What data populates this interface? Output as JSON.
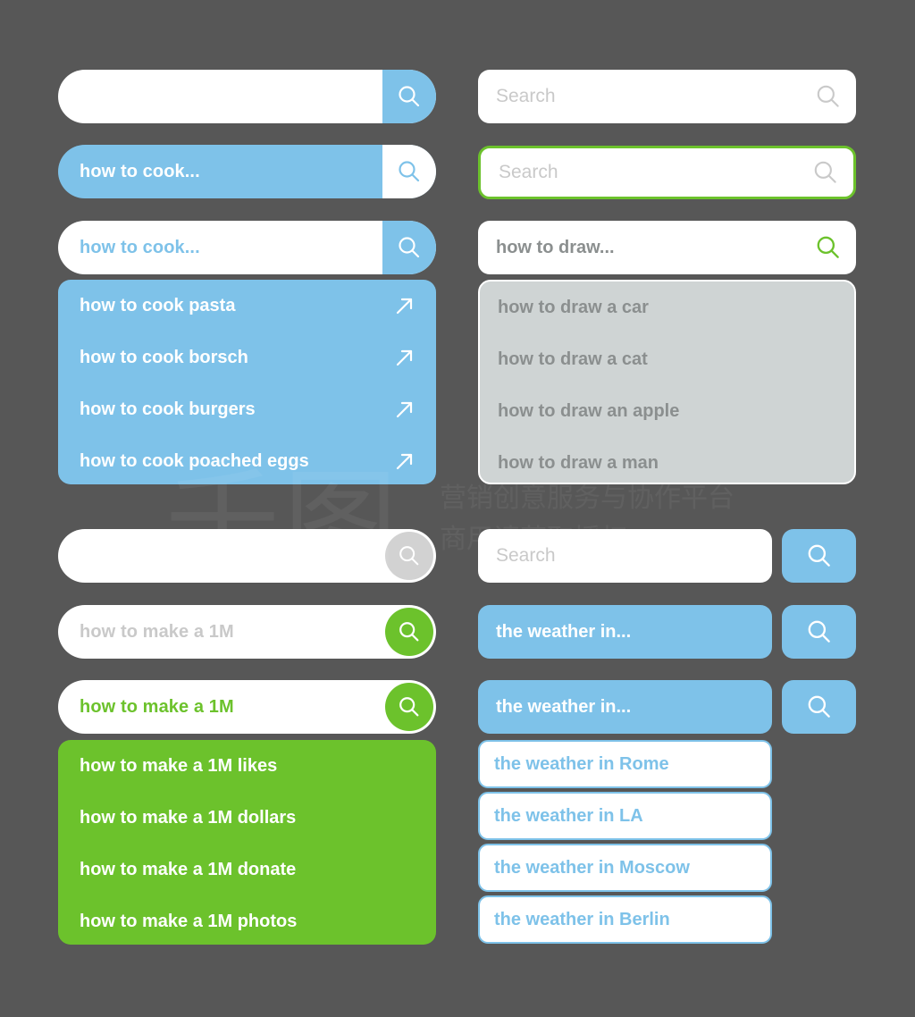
{
  "colors": {
    "background": "#575757",
    "blue": "#7ec2e9",
    "green": "#6cc22c",
    "white": "#ffffff",
    "placeholder_gray": "#c9c9c9",
    "panel_gray": "#cfd4d4",
    "panel_gray_text": "#8b8f8f",
    "icon_gray_circle": "#d2d2d2"
  },
  "left_column": {
    "bar_empty_blue_btn": {
      "value": "",
      "placeholder": "",
      "icon": "search-icon"
    },
    "bar_filled_blue": {
      "value": "how to cook...",
      "icon": "search-icon"
    },
    "bar_white_blue_text": {
      "value": "how to cook...",
      "icon": "search-icon"
    },
    "cook_suggestions": {
      "items": [
        {
          "label": "how to cook pasta",
          "icon": "arrow-up-right-icon"
        },
        {
          "label": "how to cook borsch",
          "icon": "arrow-up-right-icon"
        },
        {
          "label": "how to cook burgers",
          "icon": "arrow-up-right-icon"
        },
        {
          "label": "how to cook poached eggs",
          "icon": "arrow-up-right-icon"
        }
      ]
    },
    "bar_empty_gray_circle": {
      "value": "",
      "placeholder": "",
      "icon": "search-icon"
    },
    "bar_placeholder_green": {
      "value": "",
      "placeholder": "how to make a 1M",
      "icon": "search-icon"
    },
    "bar_filled_green": {
      "value": "how to make a 1M",
      "icon": "search-icon"
    },
    "make_suggestions": {
      "items": [
        {
          "label": "how to make a 1M likes"
        },
        {
          "label": "how to make a 1M dollars"
        },
        {
          "label": "how to make a 1M donate"
        },
        {
          "label": "how to make a 1M photos"
        }
      ]
    }
  },
  "right_column": {
    "bar_search_plain": {
      "value": "",
      "placeholder": "Search",
      "icon": "search-icon"
    },
    "bar_search_green_border": {
      "value": "",
      "placeholder": "Search",
      "icon": "search-icon"
    },
    "bar_draw_filled": {
      "value": "how to draw...",
      "icon": "search-icon"
    },
    "draw_suggestions": {
      "items": [
        {
          "label": "how to draw a car"
        },
        {
          "label": "how to draw a cat"
        },
        {
          "label": "how to draw an apple"
        },
        {
          "label": "how to draw a man"
        }
      ]
    },
    "split_search_placeholder": {
      "value": "",
      "placeholder": "Search",
      "button_icon": "search-icon"
    },
    "split_weather_1": {
      "value": "the weather in...",
      "button_icon": "search-icon"
    },
    "split_weather_2": {
      "value": "the weather in...",
      "button_icon": "search-icon"
    },
    "weather_suggestions": {
      "items": [
        {
          "label": "the weather in Rome"
        },
        {
          "label": "the weather in LA"
        },
        {
          "label": "the weather in Moscow"
        },
        {
          "label": "the weather in Berlin"
        }
      ]
    }
  },
  "watermark": {
    "logo": "千图",
    "line1": "营销创意服务与协作平台",
    "line2": "商用请获取授权"
  }
}
